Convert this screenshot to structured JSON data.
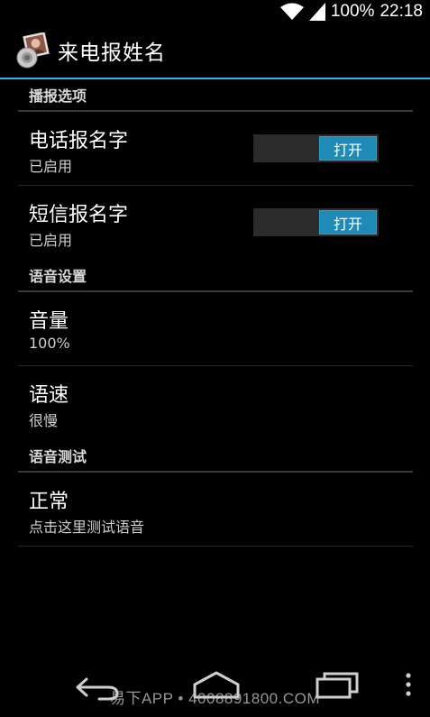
{
  "status_bar": {
    "battery_percent": "100%",
    "time": "22:18"
  },
  "action_bar": {
    "title": "来电报姓名"
  },
  "groups": [
    {
      "header": "播报选项",
      "items": [
        {
          "title": "电话报名字",
          "summary": "已启用",
          "toggle_label": "打开"
        },
        {
          "title": "短信报名字",
          "summary": "已启用",
          "toggle_label": "打开"
        }
      ]
    },
    {
      "header": "语音设置",
      "items": [
        {
          "title": "音量",
          "summary": "100%"
        },
        {
          "title": "语速",
          "summary": "很慢"
        }
      ]
    },
    {
      "header": "语音测试",
      "items": [
        {
          "title": "正常",
          "summary": "点击这里测试语音"
        }
      ]
    }
  ],
  "watermark": "易下APP • 4008891800.COM",
  "colors": {
    "accent": "#33b5e5",
    "toggle_on": "#1f8ab5",
    "background": "#000000"
  },
  "icons": {
    "wifi": "wifi-icon",
    "signal": "signal-icon",
    "back": "back-icon",
    "home": "home-icon",
    "recents": "recents-icon",
    "overflow": "overflow-menu-icon"
  }
}
